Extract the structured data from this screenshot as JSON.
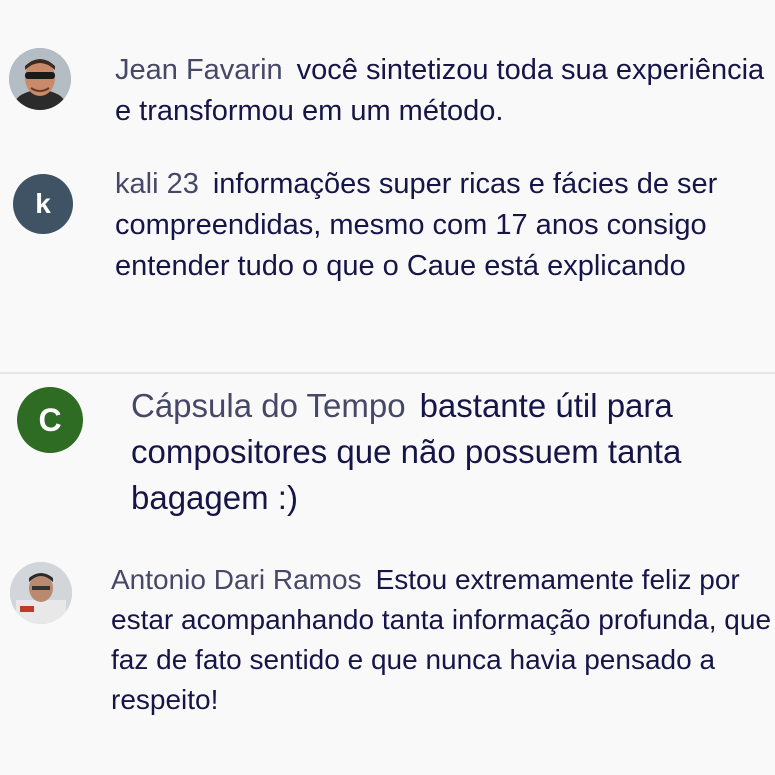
{
  "comments": [
    {
      "author": "Jean Favarin",
      "text": "você sintetizou toda sua experiência e transformou em um método.",
      "avatar_icon": "user-photo-sunglasses"
    },
    {
      "author": "kali 23",
      "text": "informações super ricas e fácies de ser compreendidas, mesmo com 17 anos consigo entender tudo o que o Caue está explicando",
      "avatar_letter": "k",
      "avatar_color": "#3f5364"
    },
    {
      "author": "Cápsula do Tempo",
      "text": "bastante útil para compositores que não possuem tanta bagagem :)",
      "avatar_letter": "C",
      "avatar_color": "#2e6b23"
    },
    {
      "author": "Antonio Dari Ramos",
      "text": "Estou extremamente feliz por estar acompanhando tanta informação profunda, que faz de fato sentido e que nunca havia pensado a respeito!",
      "avatar_icon": "user-photo-man"
    }
  ]
}
